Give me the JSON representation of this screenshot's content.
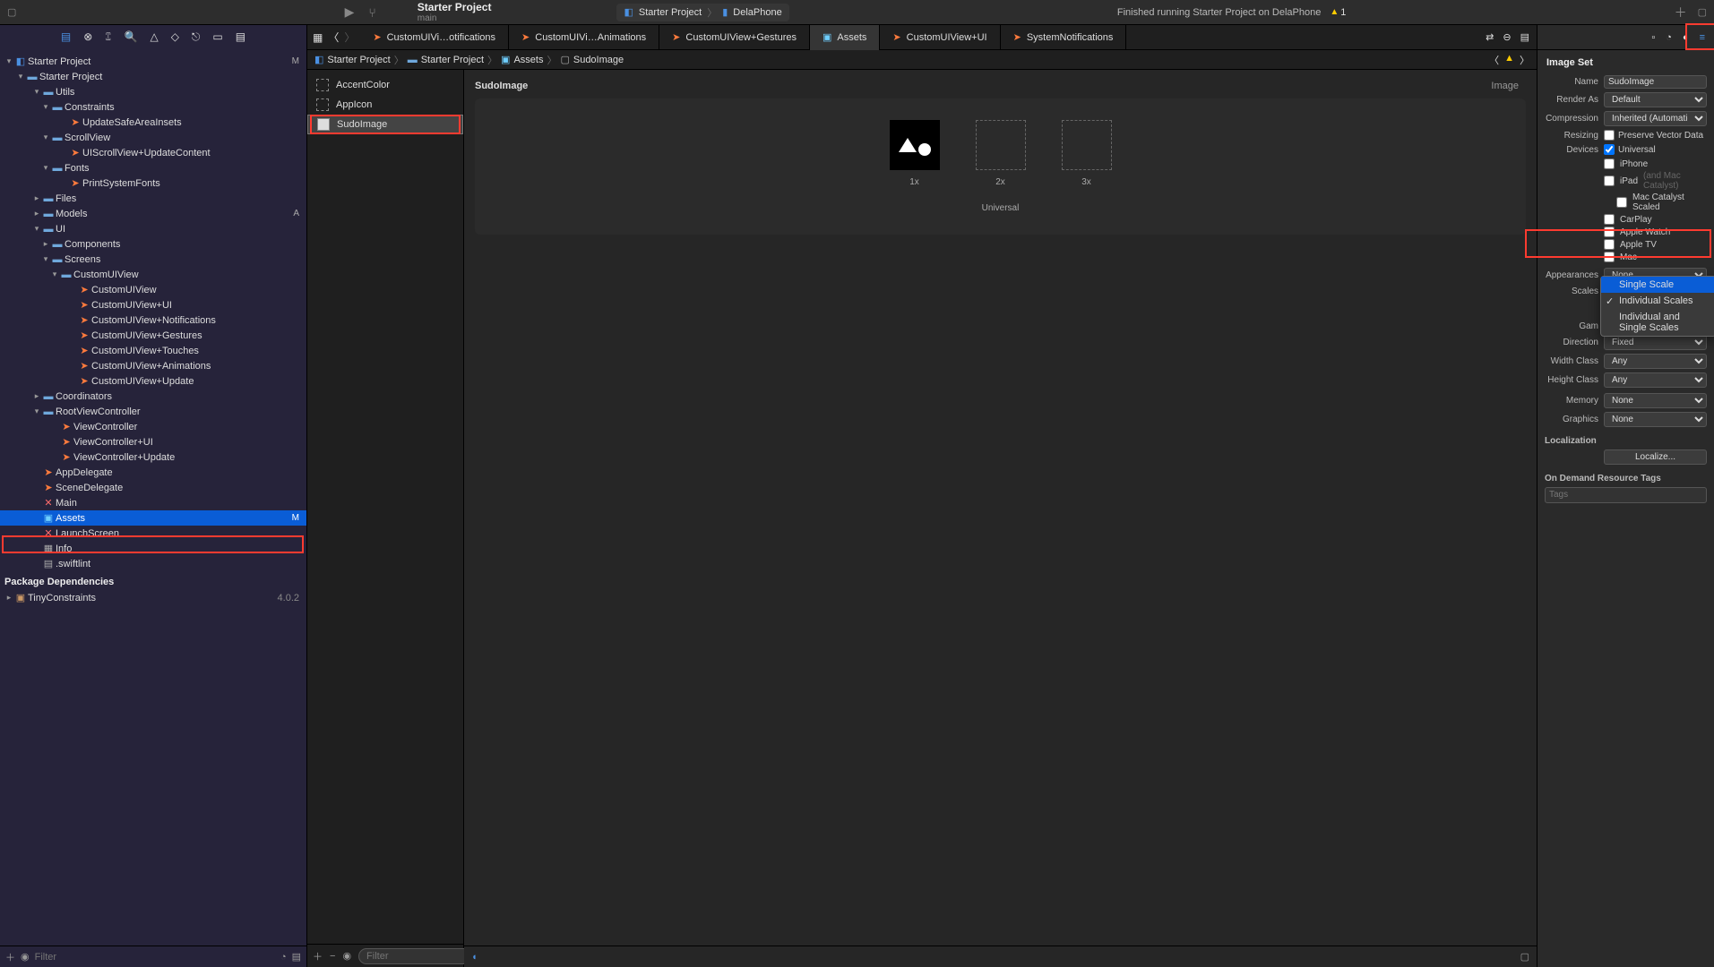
{
  "top": {
    "project_title": "Starter Project",
    "branch": "main",
    "scheme": "Starter Project",
    "device": "DelaPhone",
    "status": "Finished running Starter Project on DelaPhone",
    "warnings": "1"
  },
  "nav": {
    "root": "Starter Project",
    "root_status": "M",
    "group": "Starter Project",
    "utils": "Utils",
    "constraints": "Constraints",
    "updatesafearea": "UpdateSafeAreaInsets",
    "scrollview": "ScrollView",
    "uiscrollupdate": "UIScrollView+UpdateContent",
    "fonts": "Fonts",
    "printsystem": "PrintSystemFonts",
    "files": "Files",
    "models": "Models",
    "models_status": "A",
    "ui": "UI",
    "components": "Components",
    "screens": "Screens",
    "customuiview": "CustomUIView",
    "cuv1": "CustomUIView",
    "cuv2": "CustomUIView+UI",
    "cuv3": "CustomUIView+Notifications",
    "cuv4": "CustomUIView+Gestures",
    "cuv5": "CustomUIView+Touches",
    "cuv6": "CustomUIView+Animations",
    "cuv7": "CustomUIView+Update",
    "coordinators": "Coordinators",
    "rootvc": "RootViewController",
    "vc1": "ViewController",
    "vc2": "ViewController+UI",
    "vc3": "ViewController+Update",
    "appdelegate": "AppDelegate",
    "scenedelegate": "SceneDelegate",
    "mainsb": "Main",
    "assets": "Assets",
    "assets_status": "M",
    "launch": "LaunchScreen",
    "info": "Info",
    "swiftlint": ".swiftlint",
    "deps_header": "Package Dependencies",
    "tinyconstraints": "TinyConstraints",
    "tinyver": "4.0.2",
    "filter_ph": "Filter"
  },
  "tabs": {
    "t1": "CustomUIVi…otifications",
    "t2": "CustomUIVi…Animations",
    "t3": "CustomUIView+Gestures",
    "t4": "Assets",
    "t5": "CustomUIView+UI",
    "t6": "SystemNotifications"
  },
  "crumb": {
    "c1": "Starter Project",
    "c2": "Starter Project",
    "c3": "Assets",
    "c4": "SudoImage"
  },
  "assets": {
    "a1": "AccentColor",
    "a2": "AppIcon",
    "a3": "SudoImage",
    "filter_ph": "Filter"
  },
  "canvas": {
    "title": "SudoImage",
    "type": "Image",
    "s1": "1x",
    "s2": "2x",
    "s3": "3x",
    "universal": "Universal"
  },
  "insp": {
    "header": "Image Set",
    "name_l": "Name",
    "name_v": "SudoImage",
    "render_l": "Render As",
    "render_v": "Default",
    "comp_l": "Compression",
    "comp_v": "Inherited (Automatic)",
    "resize_l": "Resizing",
    "resize_v": "Preserve Vector Data",
    "devices_l": "Devices",
    "dev_universal": "Universal",
    "dev_iphone": "iPhone",
    "dev_ipad": "iPad",
    "dev_ipad_hint": "(and Mac Catalyst)",
    "dev_catalyst": "Mac Catalyst Scaled",
    "dev_carplay": "CarPlay",
    "dev_watch": "Apple Watch",
    "dev_tv": "Apple TV",
    "dev_mac": "Mac",
    "appear_l": "Appearances",
    "appear_v": "None",
    "scales_l": "Scales",
    "dd_single": "Single Scale",
    "dd_individual": "Individual Scales",
    "dd_both": "Individual and Single Scales",
    "gam_l": "Gam",
    "dir_l": "Direction",
    "dir_v": "Fixed",
    "wclass_l": "Width Class",
    "wclass_v": "Any",
    "hclass_l": "Height Class",
    "hclass_v": "Any",
    "mem_l": "Memory",
    "mem_v": "None",
    "gfx_l": "Graphics",
    "gfx_v": "None",
    "loc_l": "Localization",
    "loc_btn": "Localize...",
    "odr_l": "On Demand Resource Tags",
    "tags_ph": "Tags"
  }
}
